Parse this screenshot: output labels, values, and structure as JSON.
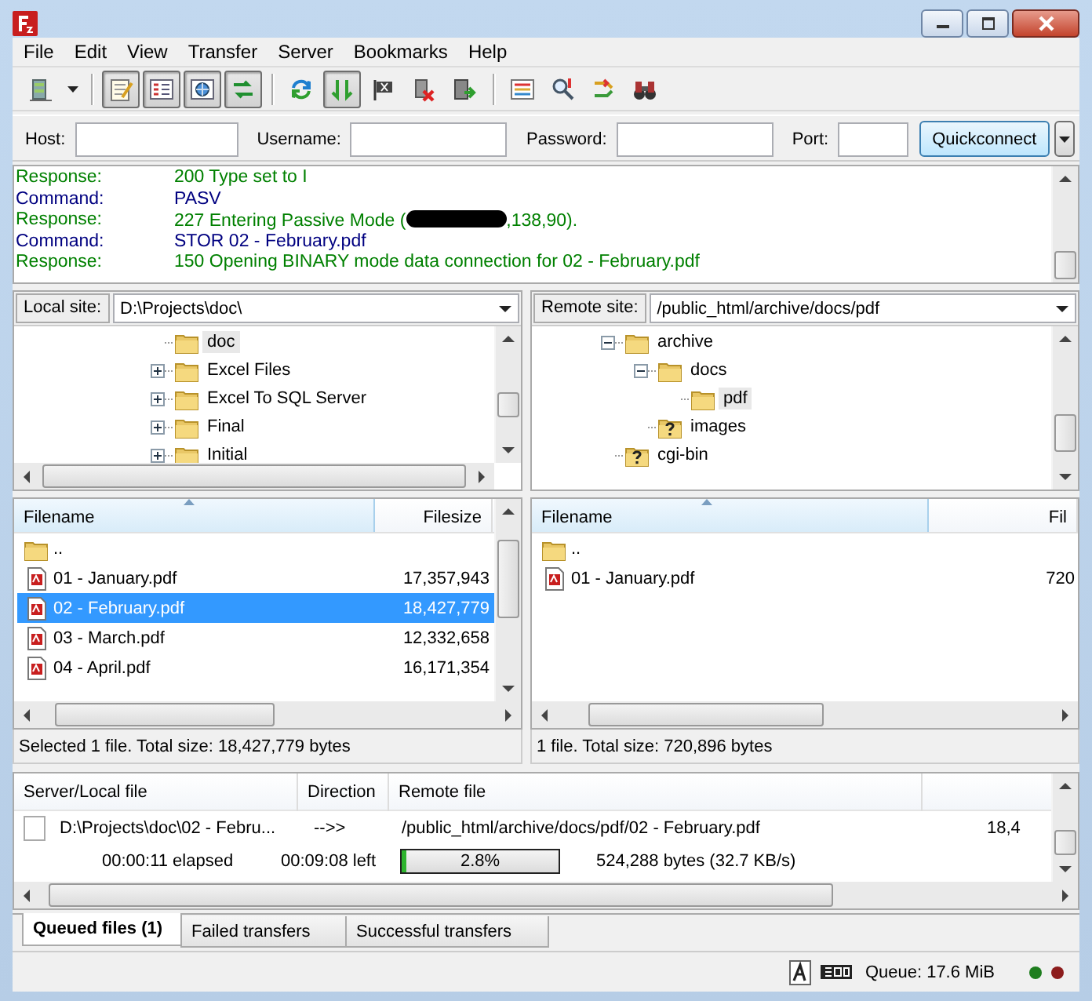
{
  "menu": [
    "File",
    "Edit",
    "View",
    "Transfer",
    "Server",
    "Bookmarks",
    "Help"
  ],
  "toolbar": [
    [
      {
        "kind": "site-manager",
        "pressed": false
      }
    ],
    [
      {
        "kind": "message-log",
        "pressed": true
      },
      {
        "kind": "local-tree",
        "pressed": true
      },
      {
        "kind": "remote-tree",
        "pressed": true
      },
      {
        "kind": "transfer-queue",
        "pressed": true
      }
    ],
    [
      {
        "kind": "refresh",
        "pressed": false
      },
      {
        "kind": "process-queue",
        "pressed": true
      },
      {
        "kind": "cancel",
        "pressed": false
      },
      {
        "kind": "disconnect",
        "pressed": false
      },
      {
        "kind": "reconnect",
        "pressed": false
      }
    ],
    [
      {
        "kind": "filter",
        "pressed": false
      },
      {
        "kind": "sync-browsing",
        "pressed": false
      },
      {
        "kind": "compare",
        "pressed": false
      },
      {
        "kind": "search",
        "pressed": false
      }
    ]
  ],
  "quickconnect": {
    "fields": [
      {
        "label": "Host:"
      },
      {
        "label": "Username:"
      },
      {
        "label": "Password:"
      },
      {
        "label": "Port:"
      }
    ],
    "button": "Quickconnect"
  },
  "log": [
    {
      "kind": "response",
      "label": "Response:",
      "message": "200 Type set to I"
    },
    {
      "kind": "command",
      "label": "Command:",
      "message": "PASV"
    },
    {
      "kind": "response",
      "label": "Response:",
      "message": "227 Entering Passive Mode (",
      "redacted": true,
      "message_end": ",138,90)."
    },
    {
      "kind": "command",
      "label": "Command:",
      "message": "STOR 02 - February.pdf"
    },
    {
      "kind": "response",
      "label": "Response:",
      "message": "150 Opening BINARY mode data connection for 02 - February.pdf"
    }
  ],
  "local": {
    "site_label": "Local site:",
    "path": "D:\\Projects\\doc\\",
    "tree": [
      {
        "name": "doc",
        "kind": "folder",
        "selected": true
      },
      {
        "name": "Excel Files",
        "kind": "folder",
        "selected": false,
        "expanded": false
      },
      {
        "name": "Excel To SQL Server",
        "kind": "folder",
        "selected": false,
        "expanded": false
      },
      {
        "name": "Final",
        "kind": "folder",
        "selected": false,
        "expanded": false
      },
      {
        "name": "Initial",
        "kind": "folder",
        "selected": false,
        "expanded": false
      }
    ],
    "files": {
      "columns": [
        "Filename",
        "Filesize"
      ],
      "rows": [
        {
          "name": "..",
          "size": "",
          "kind": "folder",
          "selected": false
        },
        {
          "name": "01 - January.pdf",
          "size": "17,357,943",
          "kind": "pdf",
          "selected": false
        },
        {
          "name": "02 - February.pdf",
          "size": "18,427,779",
          "kind": "pdf",
          "selected": true
        },
        {
          "name": "03 - March.pdf",
          "size": "12,332,658",
          "kind": "pdf",
          "selected": false
        },
        {
          "name": "04 - April.pdf",
          "size": "16,171,354",
          "kind": "pdf",
          "selected": false
        }
      ]
    },
    "status": "Selected 1 file. Total size: 18,427,779 bytes"
  },
  "remote": {
    "site_label": "Remote site:",
    "path": "/public_html/archive/docs/pdf",
    "tree": [
      {
        "name": "archive",
        "kind": "folder",
        "selected": false,
        "expanded": true,
        "children": [
          {
            "name": "docs",
            "kind": "folder",
            "selected": false,
            "expanded": true,
            "children": [
              {
                "name": "pdf",
                "kind": "folder",
                "selected": true
              }
            ]
          },
          {
            "name": "images",
            "kind": "unknown",
            "selected": false
          }
        ]
      },
      {
        "name": "cgi-bin",
        "kind": "unknown",
        "selected": false
      }
    ],
    "files": {
      "columns": [
        "Filename",
        "Fil"
      ],
      "rows": [
        {
          "name": "..",
          "size": "",
          "kind": "folder",
          "selected": false
        },
        {
          "name": "01 - January.pdf",
          "size": "720",
          "kind": "pdf",
          "selected": false
        }
      ]
    },
    "status": "1 file. Total size: 720,896 bytes"
  },
  "queue": {
    "columns": [
      "Server/Local file",
      "Direction",
      "Remote file"
    ],
    "items": [
      {
        "local": "D:\\Projects\\doc\\02 - Febru...",
        "direction": "-->>",
        "remote": "/public_html/archive/docs/pdf/02 - February.pdf",
        "size": "18,4",
        "elapsed": "00:00:11 elapsed",
        "left": "00:09:08 left",
        "level": 0.028,
        "percent": "2.8%",
        "bytes": "524,288 bytes (32.7 KB/s)"
      }
    ]
  },
  "queue_tabs": [
    {
      "label": "Queued files (1)",
      "selected": true
    },
    {
      "label": "Failed transfers",
      "selected": false
    },
    {
      "label": "Successful transfers",
      "selected": false
    }
  ],
  "status_bar": {
    "queue": "Queue: 17.6 MiB",
    "lights": [
      {
        "color": "#1e7d1e"
      },
      {
        "color": "#8c1c1c"
      }
    ]
  }
}
